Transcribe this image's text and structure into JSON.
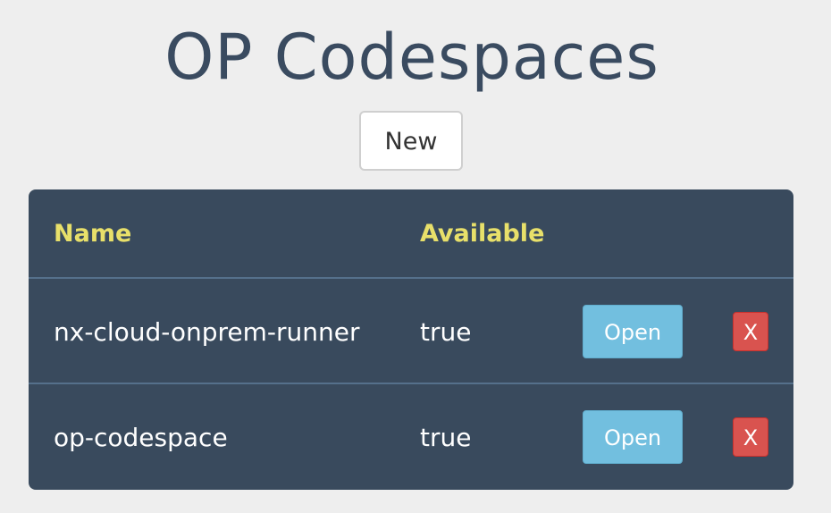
{
  "page": {
    "title": "OP Codespaces",
    "new_button_label": "New"
  },
  "table": {
    "columns": {
      "name": "Name",
      "available": "Available"
    },
    "rows": [
      {
        "name": "nx-cloud-onprem-runner",
        "available": "true",
        "open_label": "Open",
        "delete_label": "X"
      },
      {
        "name": "op-codespace",
        "available": "true",
        "open_label": "Open",
        "delete_label": "X"
      }
    ]
  },
  "colors": {
    "background": "#eeeeee",
    "title": "#3a4b60",
    "table_background": "#394a5d",
    "header_text": "#e8e06a",
    "open_button": "#72bfdf",
    "delete_button": "#d9534f"
  }
}
